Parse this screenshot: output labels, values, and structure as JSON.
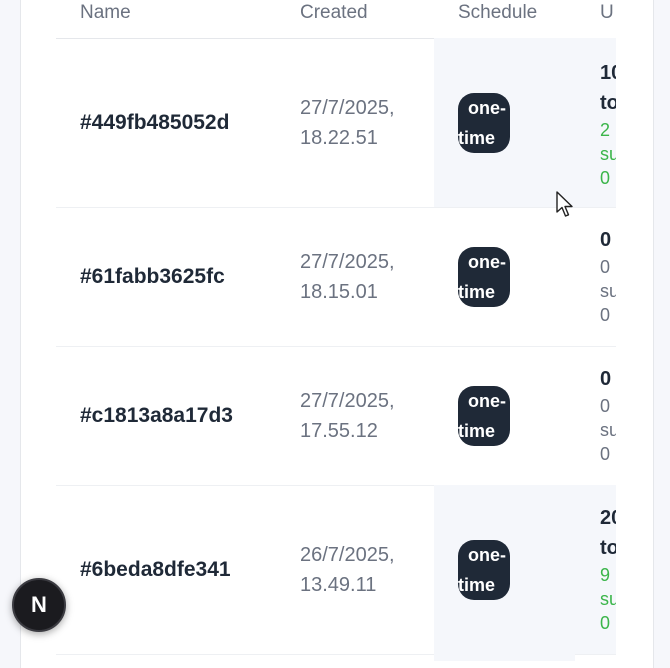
{
  "table": {
    "headers": {
      "name": "Name",
      "created": "Created",
      "schedule": "Schedule",
      "usage": "U"
    },
    "rows": [
      {
        "id": "#449fb485052d",
        "created": "27/7/2025, 18.22.51",
        "schedule_a": "one-",
        "schedule_b": "time",
        "usage_total": "10",
        "usage_total_unit": "to",
        "usage_success": "2",
        "usage_success_unit": "su",
        "usage_fail": "0",
        "highlight": true
      },
      {
        "id": "#61fabb3625fc",
        "created": "27/7/2025, 18.15.01",
        "schedule_a": "one-",
        "schedule_b": "time",
        "usage_total": "0",
        "usage_total_unit": "",
        "usage_success": "0",
        "usage_success_unit": "su",
        "usage_fail": "0",
        "highlight": false
      },
      {
        "id": "#c1813a8a17d3",
        "created": "27/7/2025, 17.55.12",
        "schedule_a": "one-",
        "schedule_b": "time",
        "usage_total": "0",
        "usage_total_unit": "",
        "usage_success": "0",
        "usage_success_unit": "su",
        "usage_fail": "0",
        "highlight": false
      },
      {
        "id": "#6beda8dfe341",
        "created": "26/7/2025, 13.49.11",
        "schedule_a": "one-",
        "schedule_b": "time",
        "usage_total": "20",
        "usage_total_unit": "to",
        "usage_success": "9",
        "usage_success_unit": "su",
        "usage_fail": "0",
        "highlight": true
      }
    ]
  },
  "fab": {
    "label": "N",
    "icon": "nextjs-logo-icon"
  },
  "colors": {
    "accent_green": "#3bb54a",
    "badge_bg": "#1f2937",
    "highlight_bg": "#f5f7fb"
  }
}
